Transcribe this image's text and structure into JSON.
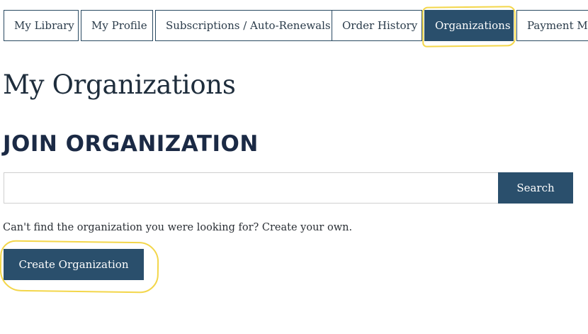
{
  "tabs": [
    {
      "label": "My Library",
      "active": false
    },
    {
      "label": "My Profile",
      "active": false
    },
    {
      "label": "Subscriptions / Auto-Renewals",
      "active": false
    },
    {
      "label": "Order History",
      "active": false
    },
    {
      "label": "Organizations",
      "active": true
    },
    {
      "label": "Payment Me",
      "active": false
    }
  ],
  "page": {
    "title": "My Organizations"
  },
  "join": {
    "heading": "JOIN ORGANIZATION",
    "search_value": "",
    "search_button": "Search"
  },
  "create": {
    "hint": "Can't find the organization you were looking for? Create your own.",
    "button": "Create Organization"
  },
  "colors": {
    "accent": "#2a4f6c",
    "highlight": "#f3d64a",
    "heading": "#1b2a45"
  }
}
